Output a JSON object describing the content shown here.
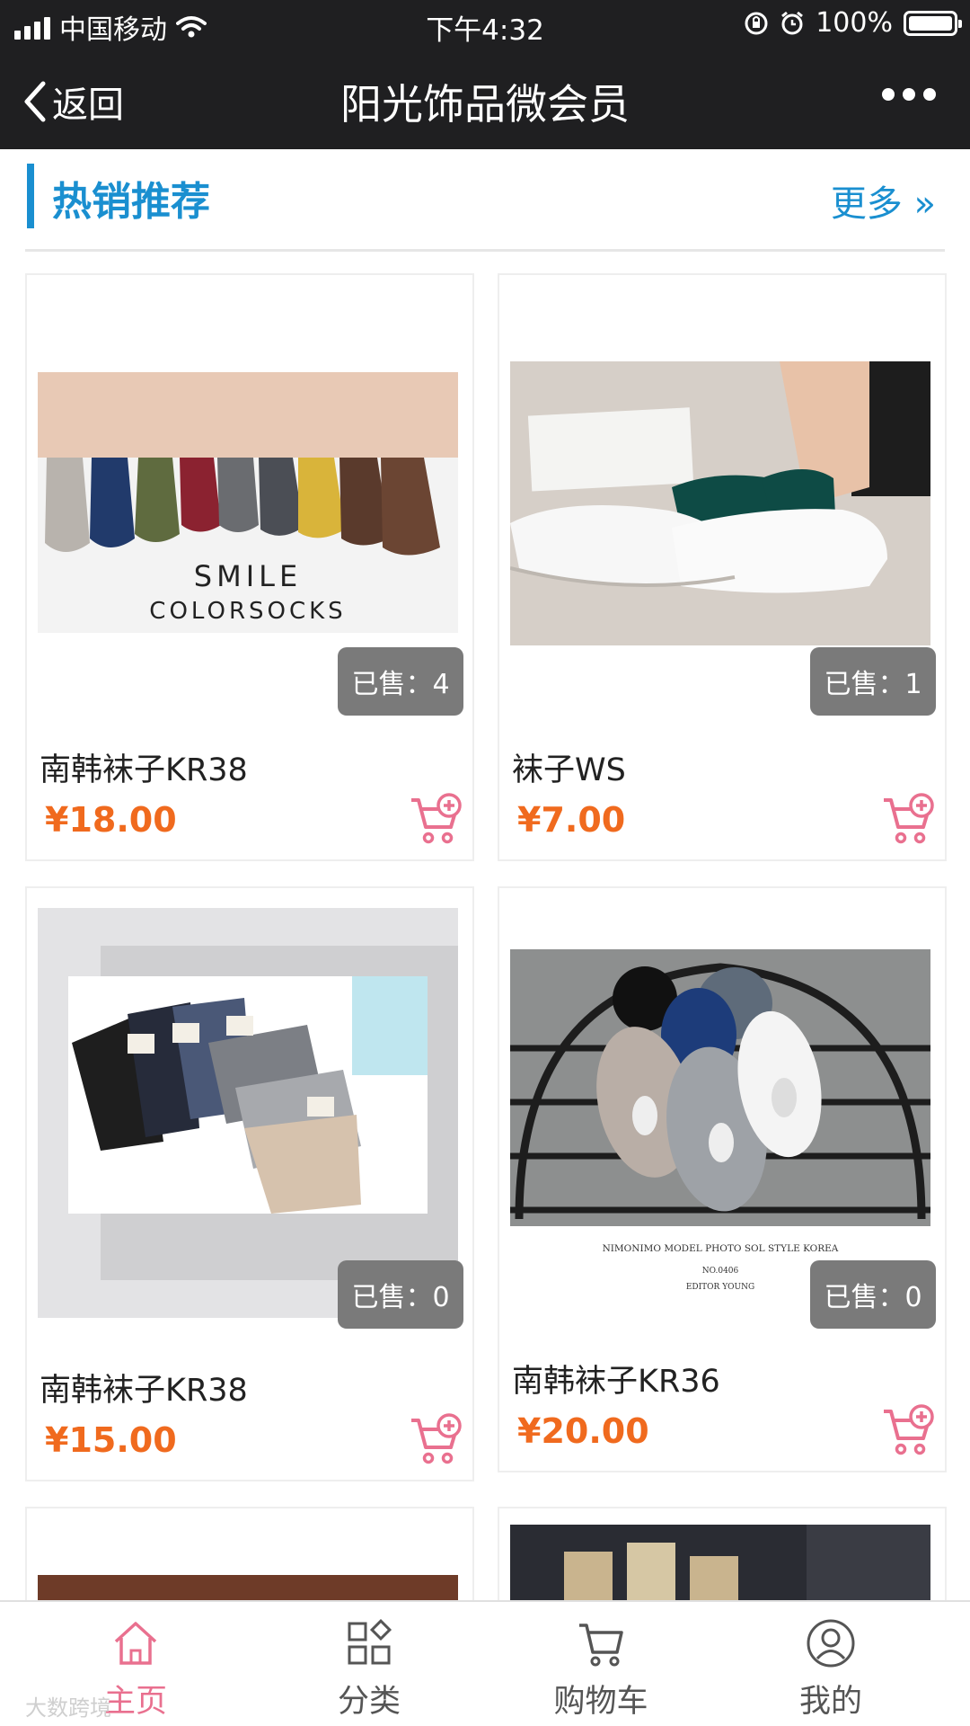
{
  "status_bar": {
    "carrier": "中国移动",
    "time": "下午4:32",
    "battery": "100%"
  },
  "nav": {
    "back_label": "返回",
    "title": "阳光饰品微会员"
  },
  "section": {
    "title": "热销推荐",
    "more_label": "更多 »"
  },
  "products": [
    {
      "name": "南韩袜子KR38",
      "price": "¥18.00",
      "sold": "已售：4",
      "image_text_1": "SMILE",
      "image_text_2": "COLORSOCKS"
    },
    {
      "name": "袜子WS",
      "price": "¥7.00",
      "sold": "已售：1"
    },
    {
      "name": "南韩袜子KR38",
      "price": "¥15.00",
      "sold": "已售：0"
    },
    {
      "name": "南韩袜子KR36",
      "price": "¥20.00",
      "sold": "已售：0",
      "image_text_1": "NIMONIMO MODEL  PHOTO SOL STYLE KOREA",
      "image_text_2": "NO.0406",
      "image_text_3": "EDITOR YOUNG"
    }
  ],
  "tabs": [
    {
      "label": "主页",
      "icon": "home-icon",
      "active": true
    },
    {
      "label": "分类",
      "icon": "category-icon",
      "active": false
    },
    {
      "label": "购物车",
      "icon": "cart-icon",
      "active": false
    },
    {
      "label": "我的",
      "icon": "user-icon",
      "active": false
    }
  ],
  "watermark": "大数跨境",
  "colors": {
    "accent_blue": "#1a8fd0",
    "price_orange": "#f06a1e",
    "cart_pink": "#e9708f",
    "topbar": "#1f1f21"
  }
}
